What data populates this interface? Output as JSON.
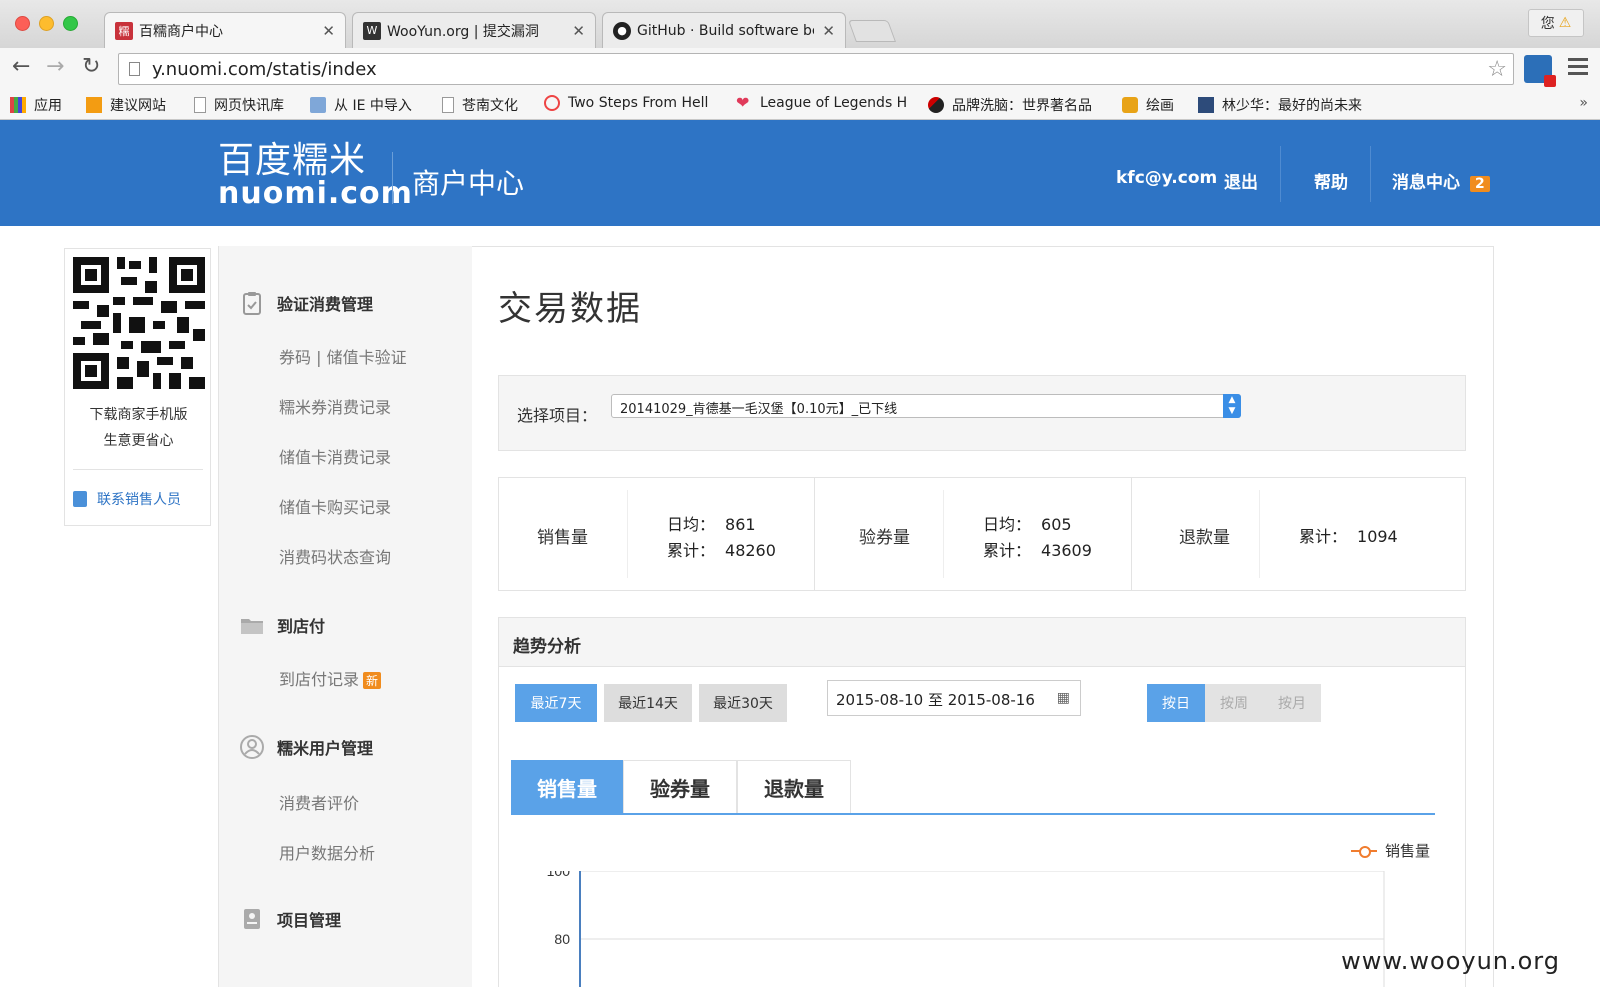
{
  "browser": {
    "tabs": [
      {
        "title": "百糯商户中心",
        "favicon": "nuomi",
        "active": true
      },
      {
        "title": "WooYun.org | 提交漏洞",
        "favicon": "wooyun",
        "active": false
      },
      {
        "title": "GitHub · Build software be",
        "favicon": "github",
        "active": false
      }
    ],
    "profile_label": "您",
    "url": "y.nuomi.com/statis/index",
    "bookmarks": [
      "应用",
      "建议网站",
      "网页快讯库",
      "从 IE 中导入",
      "苍南文化",
      "Two Steps From Hell",
      "League of Legends H",
      "品牌洗脑：世界著名品",
      "绘画",
      "林少华：最好的尚未来"
    ],
    "more_label": "»"
  },
  "header": {
    "logo_cn": "百度糯米",
    "logo_en": "nuomi.com",
    "subtitle": "商户中心",
    "user": "kfc@y.com",
    "logout": "退出",
    "help": "帮助",
    "messages": "消息中心",
    "message_count": "2"
  },
  "qr_panel": {
    "line1": "下载商家手机版",
    "line2": "生意更省心",
    "contact": "联系销售人员"
  },
  "sidebar": {
    "sections": [
      {
        "title": "验证消费管理",
        "icon": "clipboard-icon",
        "items": [
          "券码 | 储值卡验证",
          "糯米券消费记录",
          "储值卡消费记录",
          "储值卡购买记录",
          "消费码状态查询"
        ]
      },
      {
        "title": "到店付",
        "icon": "folder-icon",
        "items": [
          "到店付记录"
        ]
      },
      {
        "title": "糯米用户管理",
        "icon": "user-icon",
        "items": [
          "消费者评价",
          "用户数据分析"
        ]
      },
      {
        "title": "项目管理",
        "icon": "card-icon",
        "items": []
      }
    ],
    "new_badge": "新"
  },
  "main": {
    "title": "交易数据",
    "select_label": "选择项目：",
    "selected_project": "20141029_肯德基一毛汉堡【0.10元】_已下线",
    "stats": {
      "sales": {
        "label": "销售量",
        "avg_label": "日均：",
        "avg": "861",
        "total_label": "累计：",
        "total": "48260"
      },
      "verified": {
        "label": "验券量",
        "avg_label": "日均：",
        "avg": "605",
        "total_label": "累计：",
        "total": "43609"
      },
      "refund": {
        "label": "退款量",
        "total_label": "累计：",
        "total": "1094"
      }
    },
    "trend": {
      "title": "趋势分析",
      "ranges": [
        "最近7天",
        "最近14天",
        "最近30天"
      ],
      "date_range": "2015-08-10 至 2015-08-16",
      "granularity": [
        "按日",
        "按周",
        "按月"
      ],
      "chart_tabs": [
        "销售量",
        "验券量",
        "退款量"
      ]
    }
  },
  "chart_data": {
    "type": "line",
    "series": [
      {
        "name": "销售量",
        "values": []
      }
    ],
    "y_ticks": [
      100,
      80
    ],
    "legend": "top-right",
    "colors": {
      "series": "#f07c2e",
      "axis": "#4a7fbf"
    }
  },
  "watermark": "www.wooyun.org",
  "colors": {
    "brand": "#2e74c5",
    "accent": "#5aa2e8",
    "badge": "#f08c1e"
  }
}
